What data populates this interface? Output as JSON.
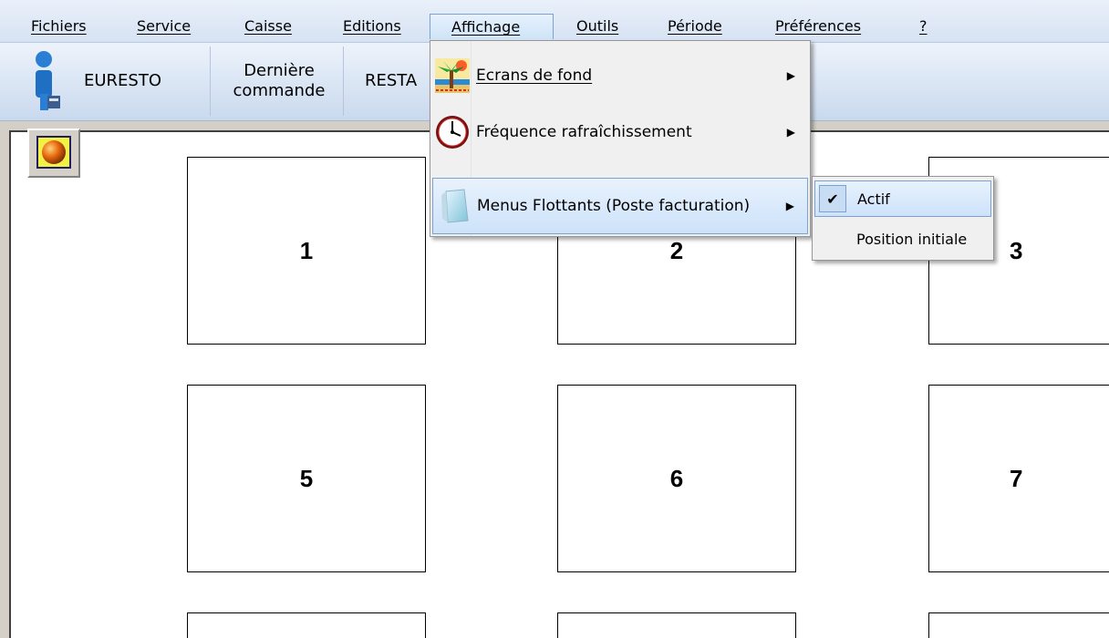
{
  "menubar": {
    "items": [
      {
        "label": "Fichiers"
      },
      {
        "label": "Service"
      },
      {
        "label": "Caisse"
      },
      {
        "label": "Editions"
      },
      {
        "label": "Affichage"
      },
      {
        "label": "Outils"
      },
      {
        "label": "Période"
      },
      {
        "label": "Préférences"
      },
      {
        "label": "?"
      }
    ]
  },
  "toolbar": {
    "user_label": "EURESTO",
    "last_order_label": "Dernière\ncommande",
    "resta_label": "RESTA"
  },
  "affichage_menu": {
    "items": [
      {
        "label": "Ecrans de fond",
        "icon": "palm-tree-icon"
      },
      {
        "label": "Fréquence rafraîchissement",
        "icon": "clock-icon"
      },
      {
        "label": "Menus Flottants (Poste facturation)",
        "icon": "floating-window-icon"
      }
    ]
  },
  "floating_submenu": {
    "items": [
      {
        "label": "Actif",
        "checked": true
      },
      {
        "label": "Position initiale",
        "checked": false
      }
    ]
  },
  "tables": [
    "1",
    "2",
    "3",
    "5",
    "6",
    "7",
    "",
    "",
    ""
  ],
  "colors": {
    "menu_highlight": "#cde2fa",
    "menu_border": "#7da2ce",
    "background": "#d4d0c8"
  }
}
